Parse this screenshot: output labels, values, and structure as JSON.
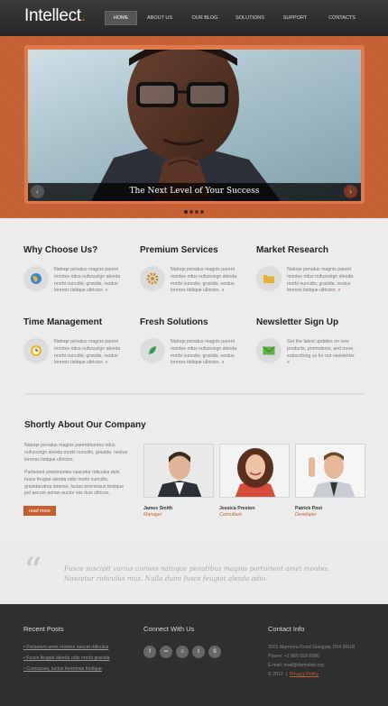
{
  "header": {
    "logo": "Intellect",
    "logo_dot": ".",
    "nav": [
      "HOME",
      "ABOUT US",
      "OUR BLOG",
      "SOLUTIONS",
      "SUPPORT",
      "CONTACTS"
    ]
  },
  "slider": {
    "caption": "The Next Level of Your Success",
    "prev_glyph": "‹",
    "next_glyph": "›",
    "slide_count": 4,
    "active_slide": 1
  },
  "features": [
    {
      "title": "Why Choose Us?",
      "icon": "globe-icon",
      "text": "Natoqe penatus magnis parent montes ndus nufusceign aleoda morbi nuncdio, gravida. nestus lorenss tistique ultricies.",
      "more": "»"
    },
    {
      "title": "Premium Services",
      "icon": "gear-icon",
      "text": "Natoqe penatus magnis parent montes ndus nufusceign aleoda morbi nuncdio, gravida. nestus lorenss tistique ultricies.",
      "more": "»"
    },
    {
      "title": "Market Research",
      "icon": "folder-icon",
      "text": "Natoqe penatus magnis parent montes ndus nufusceign aleoda morbi nuncdio, gravida. nestus lorenss tistique ultricies.",
      "more": "»"
    },
    {
      "title": "Time Management",
      "icon": "clock-icon",
      "text": "Natoqe penatus magnis parent montes ndus nufusceign aleoda morbi nuncdio, gravida. nestus lorenss tistique ultricies.",
      "more": "»"
    },
    {
      "title": "Fresh Solutions",
      "icon": "leaf-icon",
      "text": "Natoqe penatus magnis parent montes ndus nufusceign aleoda morbi nuncdio, gravida. nestus lorenss tistique ultricies.",
      "more": "»"
    },
    {
      "title": "Newsletter Sign Up",
      "icon": "mail-icon",
      "text": "Get the latest updates on new products, promotions, and more, subscribing us for our newsletter.",
      "more": "»"
    }
  ],
  "about": {
    "title": "Shortly About  Our Company",
    "para1": "Natoqe penatus magnis parentmontes ndus nufusceign aleoda morbi nuncdio, gravida. nestus lorenss tistique ultricies.",
    "para2": "Parturient  ametmontes nascetur ridiculus duin fusce feugiat aleoda odio morbi nuncdio, gravidarutrus lorenss, luctus lorenmaus tristique pel aecum aonan auctor wis duis ultrices.",
    "read_more": "read more",
    "members": [
      {
        "name": "James Smith",
        "role": "Manager"
      },
      {
        "name": "Jessica Preston",
        "role": "Consultant"
      },
      {
        "name": "Patrick Pool",
        "role": "Developer"
      }
    ]
  },
  "quote": {
    "mark": "“",
    "text": "Fusce suscipit varius cumeis natoque penatibus magnis parturient amet montes. Nascetur ridiculus mus. Nulla duim fusce feugiat alesda odio."
  },
  "footer": {
    "recent_posts_title": "Recent Posts",
    "posts": [
      "Parturient amet montes nascet ridiculus",
      "Fusce feugiat aleoda odio morbi gravida",
      "Cumsanes, luctus lorenmas tristique"
    ],
    "connect_title": "Connect With Us",
    "social": [
      {
        "icon": "facebook-icon",
        "glyph": "f"
      },
      {
        "icon": "flickr-icon",
        "glyph": "••"
      },
      {
        "icon": "rss-icon",
        "glyph": "≡"
      },
      {
        "icon": "twitter-icon",
        "glyph": "t"
      },
      {
        "icon": "skype-icon",
        "glyph": "S"
      }
    ],
    "contact_title": "Contact Info",
    "address": "3001 Marmora Road Glasgow, D04 89GR",
    "phone": "Phone: +1 800 559 6580",
    "email": "E-mail: mail@demolink.org",
    "copyright": "© 2012",
    "separator": "|",
    "privacy": "Privacy Policy"
  },
  "colors": {
    "accent": "#c45f31",
    "header": "#2b2b2b",
    "footer": "#2f2f2f"
  }
}
